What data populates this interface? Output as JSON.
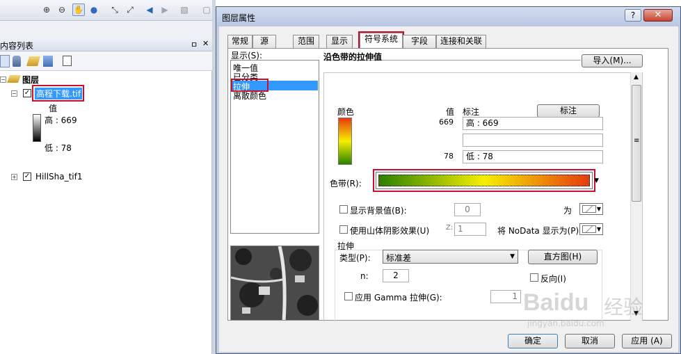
{
  "toc": {
    "title": "内容列表",
    "pin": "ㅁ",
    "close": "✕",
    "root_label": "图层",
    "layer1": {
      "name": "高程下载.tif",
      "value_header": "值",
      "high": "高 : 669",
      "low": "低 : 78"
    },
    "layer2": {
      "name": "HillSha_tif1"
    }
  },
  "dialog": {
    "title": "图层属性",
    "help": "?",
    "close": "✕",
    "tabs": [
      "常规",
      "源",
      "范围",
      "显示",
      "符号系统",
      "字段",
      "连接和关联"
    ],
    "active_tab": "符号系统",
    "show_label": "显示(S):",
    "show_list": [
      "唯一值",
      "已分类",
      "拉伸",
      "离散颜色"
    ],
    "selected_show": "拉伸",
    "heading": "沿色带的拉伸值",
    "import_button": "导入(M)...",
    "color_col": "颜色",
    "value_col": "值",
    "label_col": "标注",
    "label_button": "标注",
    "high_value": "669",
    "low_value": "78",
    "high_label": "高 : 669",
    "mid_label": "",
    "low_label": "低 : 78",
    "colorramp_label": "色带(R):",
    "show_background_label": "显示背景值(B):",
    "background_value": "0",
    "as_label": "为",
    "hillshade_label": "使用山体阴影效果(U)",
    "z_label": "Z:",
    "z_value": "1",
    "nodata_label": "将 NoData 显示为(P)",
    "stretch_group": "拉伸",
    "type_label": "类型(P):",
    "type_value": "标准差",
    "histogram_button": "直方图(H)",
    "n_label": "n:",
    "n_value": "2",
    "invert_label": "反向(I)",
    "gamma_label": "应用 Gamma 拉伸(G):",
    "gamma_value": "1",
    "ok_button": "确定",
    "cancel_button": "取消",
    "apply_button": "应用 (A)",
    "colors": {
      "ramp_start": "#2a8000",
      "ramp_mid": "#f6ef00",
      "ramp_end": "#e63a10",
      "highlight": "#3399ff",
      "red_box": "#c8102e"
    }
  },
  "watermark": {
    "logo": "Baidu",
    "cn": "经验",
    "url": "jingyan.baidu.com"
  }
}
